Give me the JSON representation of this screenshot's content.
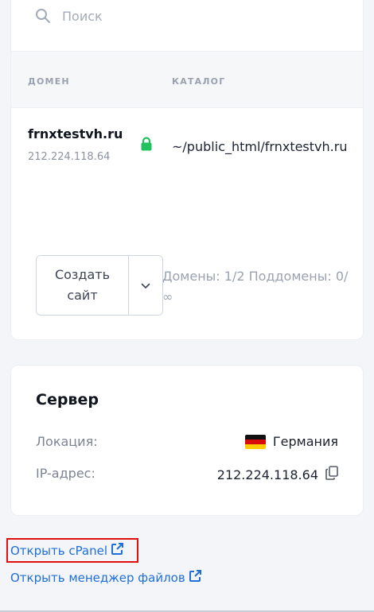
{
  "search": {
    "placeholder": "Поиск"
  },
  "table": {
    "headers": {
      "domain": "ДОМЕН",
      "directory": "КАТАЛОГ"
    },
    "rows": [
      {
        "domain": "frnxtestvh.ru",
        "ip": "212.224.118.64",
        "directory": "~/public_html/frnxtestvh.ru",
        "ssl_icon": "lock-icon"
      }
    ]
  },
  "actions": {
    "create_site_label": "Создать сайт",
    "dropdown_icon": "chevron-down-icon",
    "quota_text": "Домены: 1/2   Поддомены: 0/∞"
  },
  "server": {
    "title": "Сервер",
    "location_label": "Локация:",
    "location_value": "Германия",
    "location_flag": "germany-flag",
    "ip_label": "IP-адрес:",
    "ip_value": "212.224.118.64",
    "copy_icon": "copy-icon"
  },
  "links": {
    "cpanel": "Открыть cPanel",
    "file_manager": "Открыть менеджер файлов",
    "external_icon": "external-link-icon"
  },
  "colors": {
    "accent_link": "#1f6fd9",
    "ssl_green": "#21c25e",
    "highlight": "#e01010"
  }
}
